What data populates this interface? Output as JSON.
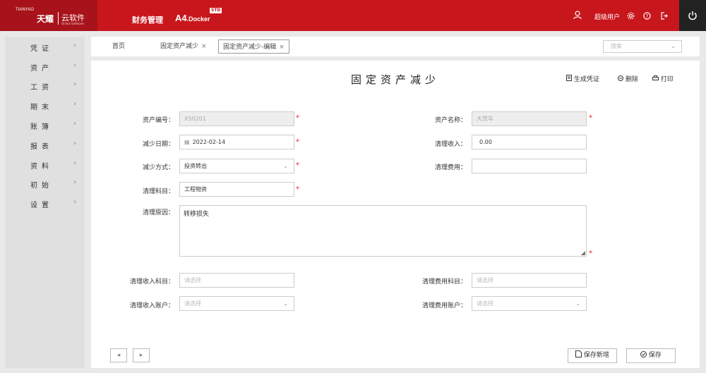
{
  "header": {
    "logo_small": "TIANYAO",
    "logo_main": "天耀",
    "logo_sub": "云软件",
    "logo_tiny": "Online Software",
    "product": "财务管理",
    "product_name": "A4",
    "product_name_sub": ".Docker",
    "badge": "STD",
    "user_icon": "user-icon",
    "user_name": "超级用户",
    "icons": [
      "settings-icon",
      "help-icon",
      "logout-icon",
      "power-icon"
    ]
  },
  "sidebar": {
    "items": [
      {
        "label": "凭证"
      },
      {
        "label": "资产"
      },
      {
        "label": "工资"
      },
      {
        "label": "期末"
      },
      {
        "label": "账簿"
      },
      {
        "label": "报表"
      },
      {
        "label": "资料"
      },
      {
        "label": "初始"
      },
      {
        "label": "设置"
      }
    ]
  },
  "tabs": {
    "home": "首页",
    "tab1": "固定资产减少",
    "tab2": "固定资产减少-编辑",
    "close": "×",
    "search_placeholder": "搜索"
  },
  "page": {
    "title": "固定资产减少",
    "btn_voucher": "生成凭证",
    "btn_delete": "删除",
    "btn_print": "打印"
  },
  "form": {
    "asset_no_label": "资产编号：",
    "asset_no_value": "XS0201",
    "asset_name_label": "资产名称：",
    "asset_name_value": "大货车",
    "reduce_date_label": "减少日期：",
    "reduce_date_value": "2022-02-14",
    "clear_income_label": "清理收入：",
    "clear_income_value": "0.00",
    "reduce_mode_label": "减少方式：",
    "reduce_mode_value": "投资转出",
    "clear_fee_label": "清理费用：",
    "clear_fee_value": "",
    "clear_subject_label": "清理科目：",
    "clear_subject_value": "工程物资",
    "clear_reason_label": "清理原因：",
    "clear_reason_value": "转移损失",
    "income_subject_label": "清理收入科目：",
    "income_subject_placeholder": "请选择",
    "fee_subject_label": "清理费用科目：",
    "fee_subject_placeholder": "请选择",
    "income_account_label": "清理收入账户：",
    "income_account_placeholder": "请选择",
    "fee_account_label": "清理费用账户：",
    "fee_account_placeholder": "请选择",
    "required_mark": "*"
  },
  "footer": {
    "prev": "◂",
    "next": "▸",
    "save_new": "保存新增",
    "save": "保存"
  },
  "colors": {
    "brand_red": "#c8161d",
    "required": "#e02020"
  }
}
